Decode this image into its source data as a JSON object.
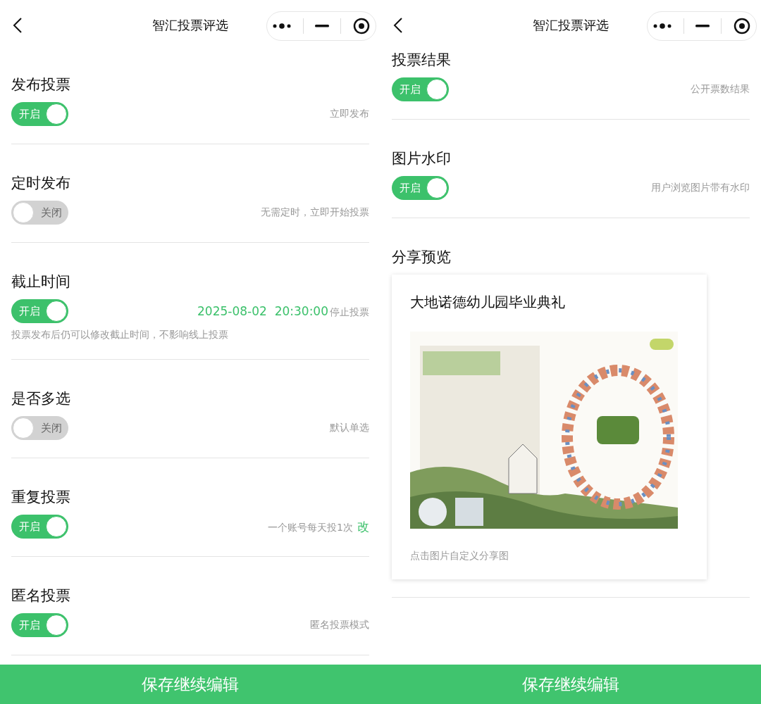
{
  "screens": [
    {
      "title": "智汇投票评选",
      "settings": [
        {
          "label": "发布投票",
          "on": true,
          "toggle_text": "开启",
          "note": "立即发布"
        },
        {
          "label": "定时发布",
          "on": false,
          "toggle_text": "关闭",
          "note": "无需定时，立即开始投票"
        },
        {
          "label": "截止时间",
          "on": true,
          "toggle_text": "开启",
          "value": "2025-08-02  20:30:00",
          "note": "停止投票",
          "hint": "投票发布后仍可以修改截止时间，不影响线上投票"
        },
        {
          "label": "是否多选",
          "on": false,
          "toggle_text": "关闭",
          "note": "默认单选"
        },
        {
          "label": "重复投票",
          "on": true,
          "toggle_text": "开启",
          "note": "一个账号每天投1次",
          "link": "改"
        },
        {
          "label": "匿名投票",
          "on": true,
          "toggle_text": "开启",
          "note": "匿名投票模式"
        }
      ],
      "save_button": "保存继续编辑"
    },
    {
      "title": "智汇投票评选",
      "settings": [
        {
          "label": "投票结果",
          "on": true,
          "toggle_text": "开启",
          "note": "公开票数结果"
        },
        {
          "label": "图片水印",
          "on": true,
          "toggle_text": "开启",
          "note": "用户浏览图片带有水印"
        }
      ],
      "share_preview": {
        "label": "分享预览",
        "card_title": "大地诺德幼儿园毕业典礼",
        "caption": "点击图片自定义分享图"
      },
      "save_button": "保存继续编辑"
    }
  ]
}
